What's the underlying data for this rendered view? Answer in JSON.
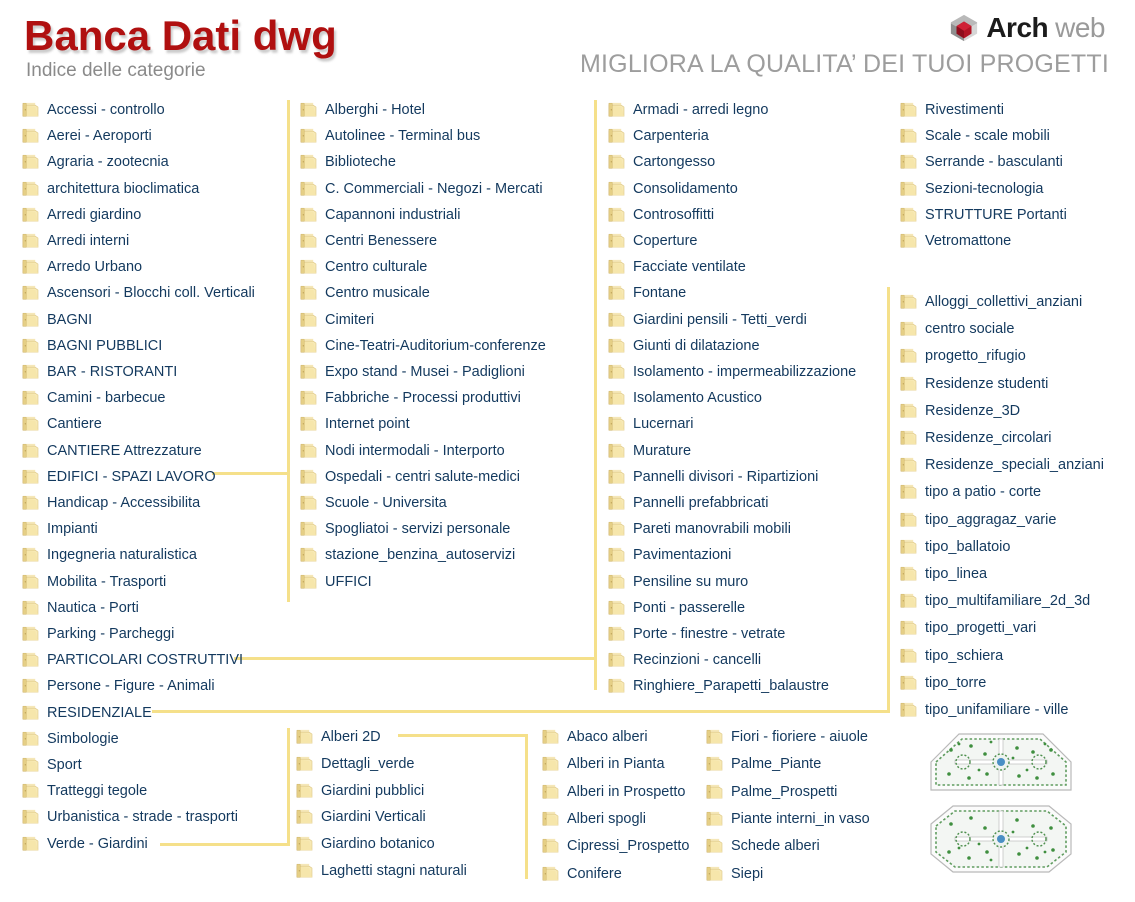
{
  "header": {
    "title": "Banca Dati dwg",
    "subtitle": "Indice delle categorie",
    "tagline": "MIGLIORA LA QUALITA’ DEI TUOI PROGETTI",
    "brand_primary": "Arch",
    "brand_secondary": "web",
    "title_color": "#b01010",
    "tagline_color": "#9d9d9d",
    "brand_mark_color": "#b01424",
    "link_color": "#13395e",
    "connector_color": "#f5e08a"
  },
  "columns": {
    "col1": [
      "Accessi - controllo",
      "Aerei - Aeroporti",
      "Agraria - zootecnia",
      "architettura bioclimatica",
      "Arredi giardino",
      "Arredi interni",
      "Arredo Urbano",
      "Ascensori - Blocchi coll. Verticali",
      "BAGNI",
      "BAGNI PUBBLICI",
      "BAR - RISTORANTI",
      "Camini - barbecue",
      "Cantiere",
      "CANTIERE Attrezzature",
      "EDIFICI - SPAZI LAVORO",
      "Handicap - Accessibilita",
      "Impianti",
      "Ingegneria naturalistica",
      "Mobilita - Trasporti",
      "Nautica - Porti",
      "Parking - Parcheggi",
      "PARTICOLARI COSTRUTTIVI",
      "Persone - Figure - Animali",
      "RESIDENZIALE",
      "Simbologie",
      "Sport",
      "Tratteggi tegole",
      "Urbanistica - strade - trasporti",
      "Verde - Giardini"
    ],
    "col2": [
      "Alberghi - Hotel",
      "Autolinee - Terminal bus",
      "Biblioteche",
      "C. Commerciali - Negozi - Mercati",
      "Capannoni industriali",
      "Centri Benessere",
      "Centro culturale",
      "Centro musicale",
      "Cimiteri",
      "Cine-Teatri-Auditorium-conferenze",
      "Expo stand - Musei - Padiglioni",
      "Fabbriche - Processi produttivi",
      "Internet point",
      "Nodi intermodali - Interporto",
      "Ospedali - centri salute-medici",
      "Scuole - Universita",
      "Spogliatoi - servizi personale",
      "stazione_benzina_autoservizi",
      "UFFICI"
    ],
    "col3": [
      "Armadi - arredi legno",
      "Carpenteria",
      "Cartongesso",
      "Consolidamento",
      "Controsoffitti",
      "Coperture",
      "Facciate ventilate",
      "Fontane",
      "Giardini pensili - Tetti_verdi",
      "Giunti di dilatazione",
      "Isolamento - impermeabilizzazione",
      "Isolamento Acustico",
      "Lucernari",
      "Murature",
      "Pannelli divisori - Ripartizioni",
      "Pannelli prefabbricati",
      "Pareti manovrabili mobili",
      "Pavimentazioni",
      "Pensiline su muro",
      "Ponti - passerelle",
      "Porte - finestre - vetrate",
      "Recinzioni - cancelli",
      "Ringhiere_Parapetti_balaustre"
    ],
    "col4a": [
      "Rivestimenti",
      "Scale - scale mobili",
      "Serrande - basculanti",
      "Sezioni-tecnologia",
      "STRUTTURE Portanti",
      "Vetromattone"
    ],
    "col4b": [
      "Alloggi_collettivi_anziani",
      "centro sociale",
      "progetto_rifugio",
      "Residenze studenti",
      "Residenze_3D",
      "Residenze_circolari",
      "Residenze_speciali_anziani",
      "tipo a patio - corte",
      "tipo_aggragaz_varie",
      "tipo_ballatoio",
      "tipo_linea",
      "tipo_multifamiliare_2d_3d",
      "tipo_progetti_vari",
      "tipo_schiera",
      "tipo_torre",
      "tipo_unifamiliare - ville"
    ],
    "verde_col1": [
      "Alberi 2D",
      "Dettagli_verde",
      "Giardini pubblici",
      "Giardini Verticali",
      "Giardino botanico",
      "Laghetti stagni naturali"
    ],
    "verde_col2": [
      "Abaco alberi",
      "Alberi in Pianta",
      "Alberi in Prospetto",
      "Alberi spogli",
      "Cipressi_Prospetto",
      "Conifere"
    ],
    "verde_col3": [
      "Fiori - fioriere - aiuole",
      "Palme_Piante",
      "Palme_Prospetti",
      "Piante interni_in vaso",
      "Schede alberi",
      "Siepi"
    ]
  }
}
